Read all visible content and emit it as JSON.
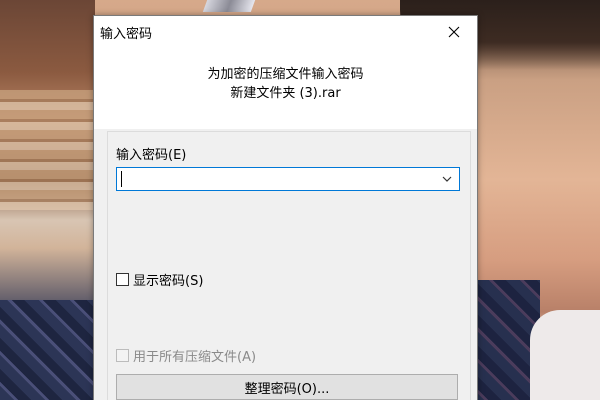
{
  "dialog": {
    "title": "输入密码",
    "prompt_line1": "为加密的压缩文件输入密码",
    "prompt_line2": "新建文件夹 (3).rar",
    "password_label": "输入密码(E)",
    "password_value": "",
    "show_password_label": "显示密码(S)",
    "show_password_checked": false,
    "use_for_all_label": "用于所有压缩文件(A)",
    "use_for_all_checked": false,
    "use_for_all_enabled": false,
    "organize_button_label": "整理密码(O)...",
    "close_icon": "close-icon",
    "dropdown_icon": "chevron-down-icon"
  },
  "colors": {
    "focus_border": "#0078d7",
    "dialog_bg": "#f0f0f0",
    "header_bg": "#ffffff",
    "disabled_text": "#8a8a8a",
    "button_bg": "#e1e1e1"
  }
}
